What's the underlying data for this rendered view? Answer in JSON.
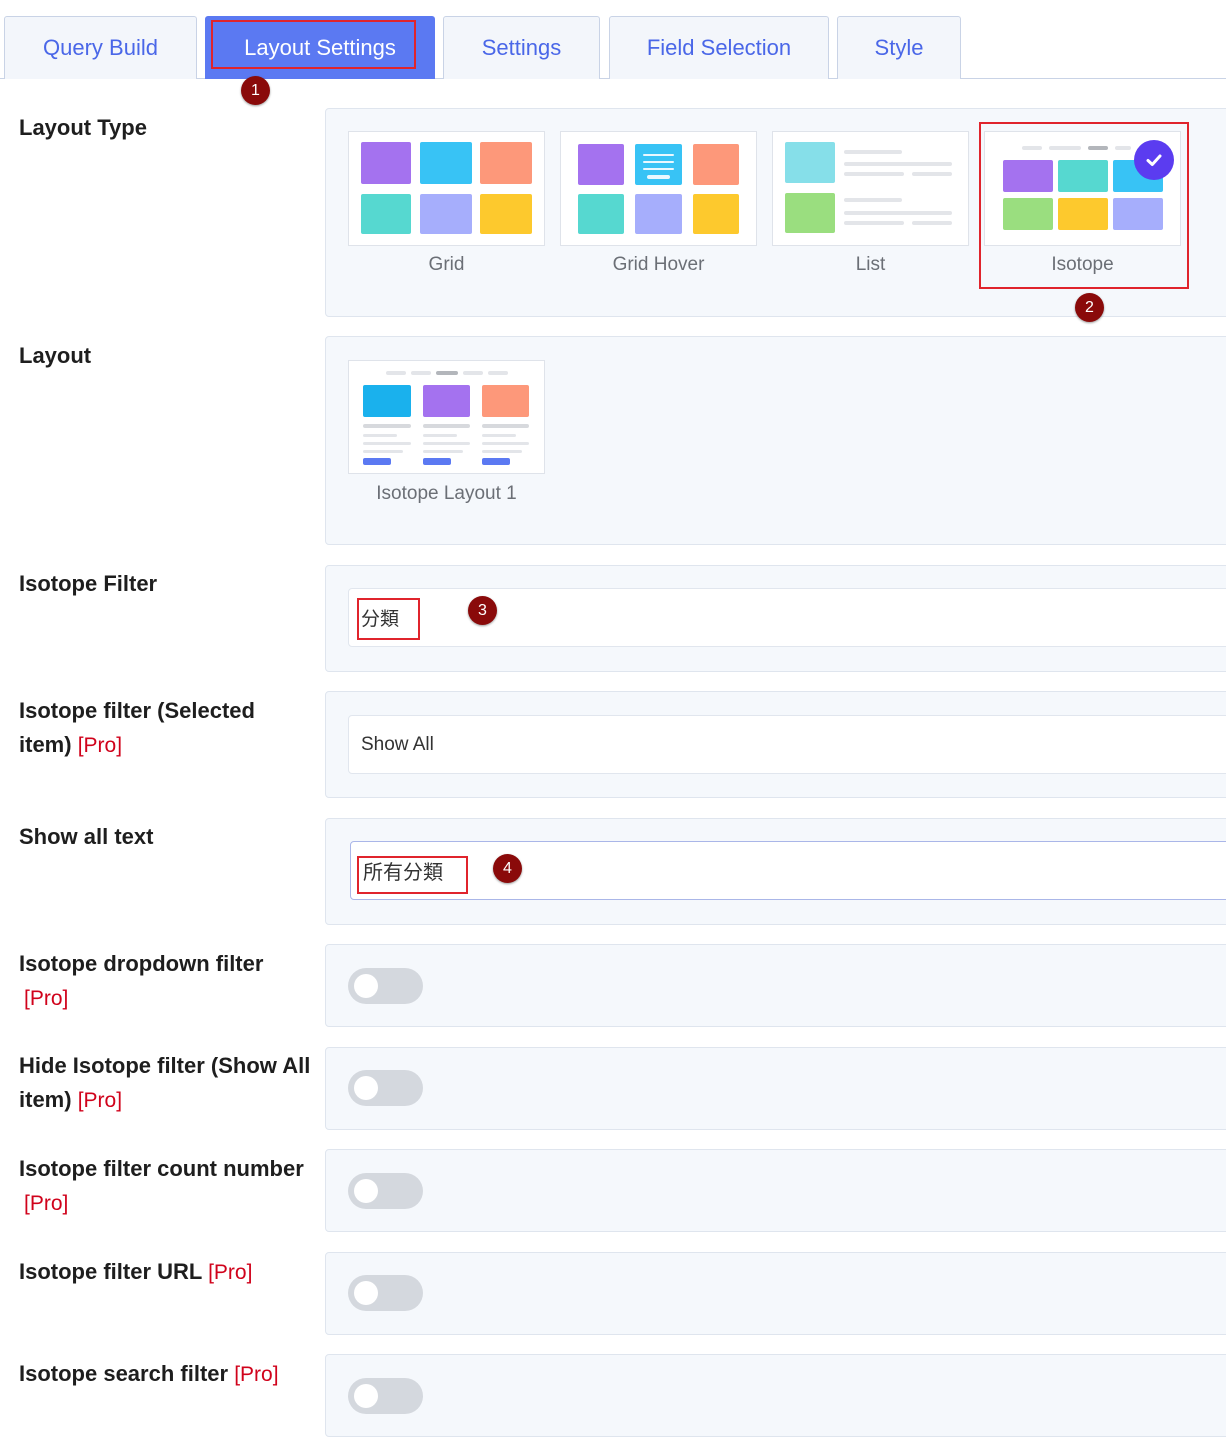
{
  "tabs": [
    {
      "label": "Query Build"
    },
    {
      "label": "Layout Settings"
    },
    {
      "label": "Settings"
    },
    {
      "label": "Field Selection"
    },
    {
      "label": "Style"
    }
  ],
  "active_tab": "Layout Settings",
  "markers": [
    "1",
    "2",
    "3",
    "4"
  ],
  "layout_type": {
    "label": "Layout Type",
    "options": [
      {
        "label": "Grid"
      },
      {
        "label": "Grid Hover"
      },
      {
        "label": "List"
      },
      {
        "label": "Isotope"
      }
    ],
    "selected": "Isotope"
  },
  "layout": {
    "label": "Layout",
    "options": [
      {
        "label": "Isotope Layout 1"
      }
    ]
  },
  "isotope_filter": {
    "label": "Isotope Filter",
    "value": "分類"
  },
  "isotope_filter_selected": {
    "label": "Isotope filter (Selected",
    "label2": "item)",
    "pro": "[Pro]",
    "value": "Show All"
  },
  "show_all_text": {
    "label": "Show all text",
    "value": "所有分類"
  },
  "dropdown_filter": {
    "label": "Isotope dropdown filter",
    "pro": "[Pro]",
    "enabled": false
  },
  "hide_filter": {
    "label": "Hide Isotope filter (Show All",
    "label2": "item)",
    "pro": "[Pro]",
    "enabled": false
  },
  "count_number": {
    "label": "Isotope filter count number",
    "pro": "[Pro]",
    "enabled": false
  },
  "filter_url": {
    "label": "Isotope filter URL",
    "pro": "[Pro]",
    "enabled": false
  },
  "search_filter": {
    "label": "Isotope search filter",
    "pro": "[Pro]",
    "enabled": false
  },
  "colors": {
    "accent": "#5b79f2",
    "annotation": "#e0242c",
    "marker": "#8a0a0a",
    "pro": "#d0021b"
  }
}
